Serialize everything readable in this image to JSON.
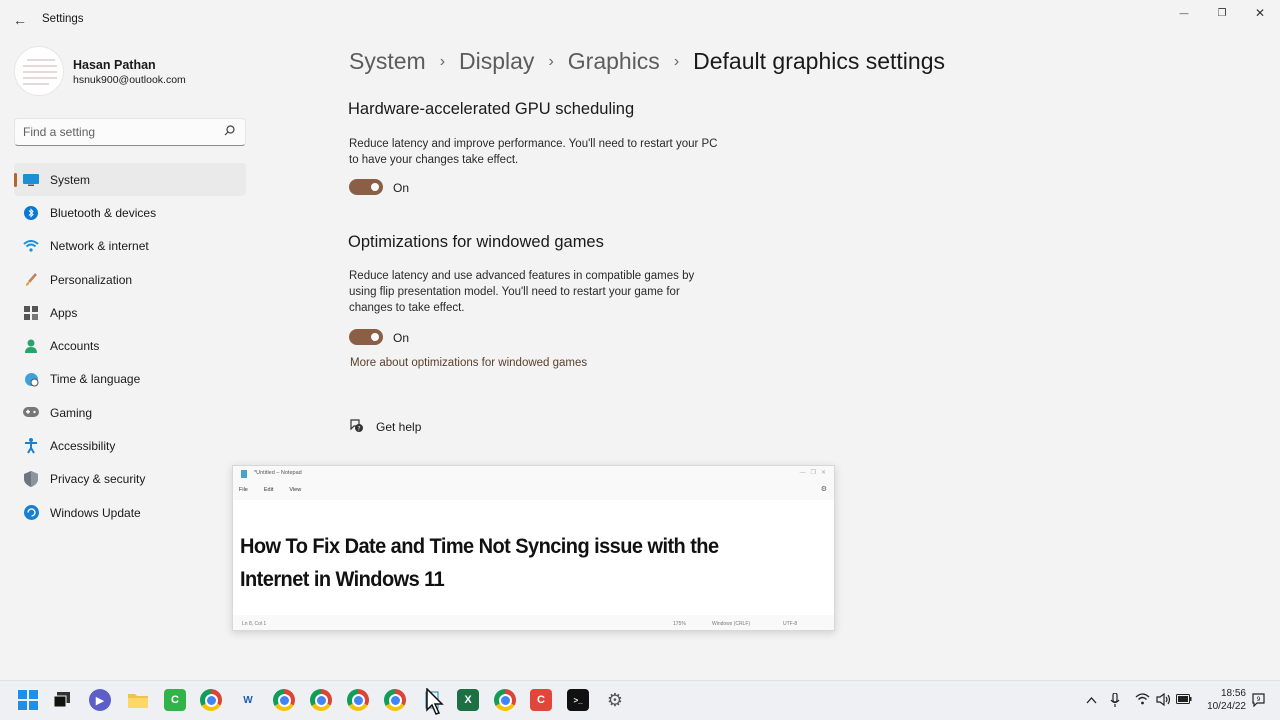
{
  "window": {
    "title": "Settings",
    "back_symbol": "←",
    "minimize_symbol": "—",
    "maximize_symbol": "❐",
    "close_symbol": "✕"
  },
  "profile": {
    "name": "Hasan Pathan",
    "email": "hsnuk900@outlook.com"
  },
  "search": {
    "placeholder": "Find a setting",
    "icon": "search-icon"
  },
  "sidebar": {
    "items": [
      {
        "label": "System",
        "icon": "system-icon",
        "active": true
      },
      {
        "label": "Bluetooth & devices",
        "icon": "bluetooth-icon"
      },
      {
        "label": "Network & internet",
        "icon": "wifi-icon"
      },
      {
        "label": "Personalization",
        "icon": "brush-icon"
      },
      {
        "label": "Apps",
        "icon": "apps-icon"
      },
      {
        "label": "Accounts",
        "icon": "person-icon"
      },
      {
        "label": "Time & language",
        "icon": "globe-clock-icon"
      },
      {
        "label": "Gaming",
        "icon": "gamepad-icon"
      },
      {
        "label": "Accessibility",
        "icon": "accessibility-icon"
      },
      {
        "label": "Privacy & security",
        "icon": "shield-icon"
      },
      {
        "label": "Windows Update",
        "icon": "update-icon"
      }
    ]
  },
  "breadcrumb": {
    "items": [
      "System",
      "Display",
      "Graphics"
    ],
    "current": "Default graphics settings",
    "separator": "›"
  },
  "sections": {
    "gpu": {
      "title": "Hardware-accelerated GPU scheduling",
      "description": "Reduce latency and improve performance. You'll need to restart your PC to have your changes take effect.",
      "toggle_state": "On"
    },
    "windowed": {
      "title": "Optimizations for windowed games",
      "description": "Reduce latency and use advanced features in compatible games by using flip presentation model. You'll need to restart your game for changes to take effect.",
      "toggle_state": "On",
      "link": "More about optimizations for windowed games"
    },
    "help": {
      "label": "Get help",
      "icon": "help-chat-icon"
    }
  },
  "notepad": {
    "title": "*Untitled – Notepad",
    "menu": [
      "File",
      "Edit",
      "View"
    ],
    "content": "How To Fix Date and Time Not Syncing issue with the Internet in Windows 11",
    "status": {
      "position": "Ln 8, Col 1",
      "zoom": "175%",
      "line_ending": "Windows (CRLF)",
      "encoding": "UTF-8"
    }
  },
  "taskbar": {
    "time": "18:56",
    "date": "10/24/22",
    "tray_icons": [
      "chevron-up-icon",
      "microphone-icon",
      "wifi-icon",
      "volume-icon",
      "battery-icon",
      "notification-icon"
    ]
  },
  "colors": {
    "accent": "#8a5f45",
    "active_indicator": "#b6642e",
    "background": "#f3f3f3"
  }
}
